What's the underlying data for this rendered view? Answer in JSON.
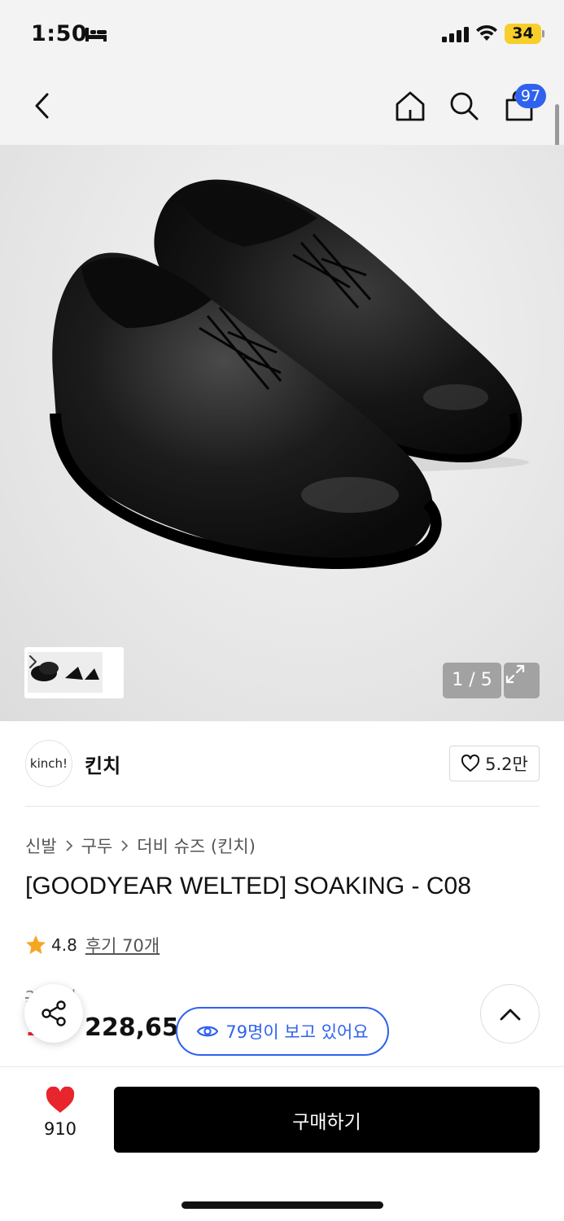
{
  "status_bar": {
    "time": "1:50",
    "battery": "34"
  },
  "nav": {
    "cart_count": "97",
    "icons": [
      "chevron-left-icon",
      "home-icon",
      "search-icon",
      "shopping-bag-icon"
    ]
  },
  "gallery": {
    "page_indicator": "1 / 5"
  },
  "brand": {
    "logo_text": "kinch!",
    "name": "킨치",
    "like_count": "5.2만"
  },
  "breadcrumb": [
    "신발",
    "구두",
    "더비 슈즈 (킨치)"
  ],
  "product": {
    "title": "[GOODYEAR WELTED] SOAKING - C08",
    "rating": "4.8",
    "review_label": "후기 70개",
    "original_price": "2 00원",
    "sale_price": "228,65",
    "discount_fragment": "1"
  },
  "viewers": {
    "label": "79명이 보고 있어요"
  },
  "bottom_bar": {
    "wish_count": "910",
    "buy_label": "구매하기"
  },
  "colors": {
    "accent": "#2f62ef",
    "heart": "#e8242c",
    "battery": "#f7ce2a",
    "star": "#f5a623"
  }
}
